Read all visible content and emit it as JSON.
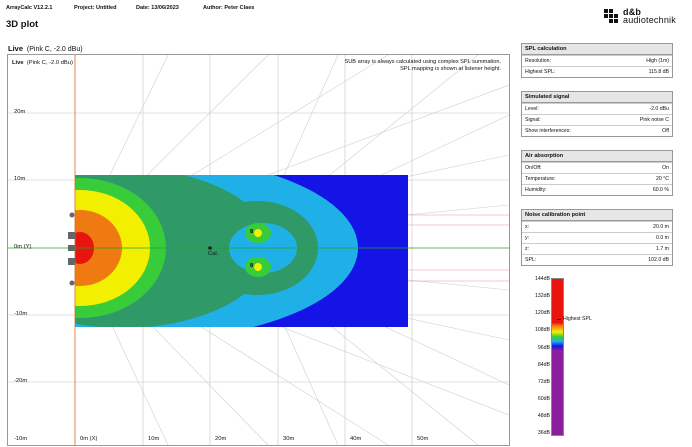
{
  "header": {
    "app": "ArrayCalc V12.2.1",
    "project": "Project: Untitled",
    "date": "Date: 13/06/2023",
    "author": "Author: Peter Claes",
    "title": "3D plot"
  },
  "logo": {
    "line1": "d&b",
    "line2": "audiotechnik"
  },
  "plot": {
    "title_bold": "Live",
    "title_rest": "(Pink C, -2.0 dBu)",
    "inner_bold": "Live",
    "inner_rest": "(Pink C, -2.0 dBu)",
    "note1": "SUB array is always calculated using complex SPL summation.",
    "note2": "SPL mapping is shown at listener height.",
    "y_ticks": [
      "20m",
      "10m",
      "0m (Y)",
      "-10m",
      "-20m"
    ],
    "x_ticks": [
      "-10m",
      "0m (X)",
      "10m",
      "20m",
      "30m",
      "40m",
      "50m"
    ],
    "cal_label": "Cal.",
    "src_a": "8",
    "src_b": "8"
  },
  "spl_calc": {
    "title": "SPL calculation",
    "rows": [
      {
        "k": "Resolution:",
        "v": "High (1m)"
      },
      {
        "k": "Highest SPL:",
        "v": "115.8 dB"
      }
    ]
  },
  "sim_signal": {
    "title": "Simulated signal",
    "rows": [
      {
        "k": "Level:",
        "v": "-2.0 dBu"
      },
      {
        "k": "Signal:",
        "v": "Pink noise C"
      },
      {
        "k": "Show interferences:",
        "v": "Off"
      }
    ]
  },
  "air": {
    "title": "Air absorption",
    "rows": [
      {
        "k": "On/Off:",
        "v": "On"
      },
      {
        "k": "Temperature:",
        "v": "20 °C"
      },
      {
        "k": "Humidity:",
        "v": "60.0 %"
      }
    ]
  },
  "noise_cal": {
    "title": "Noise calibration point",
    "rows": [
      {
        "k": "x:",
        "v": "20.0 m"
      },
      {
        "k": "y:",
        "v": "0.0 m"
      },
      {
        "k": "z:",
        "v": "1.7 m"
      },
      {
        "k": "SPL:",
        "v": "102.0 dB"
      }
    ]
  },
  "scale": {
    "labels": [
      "144dB",
      "132dB",
      "120dB",
      "108dB",
      "96dB",
      "84dB",
      "72dB",
      "60dB",
      "48dB",
      "36dB"
    ],
    "highest_label": "Highest SPL"
  },
  "colors": {
    "red": "#e8140e",
    "orange": "#f07a12",
    "yellow": "#f2f000",
    "green": "#38cc3a",
    "darkgreen": "#2f9a68",
    "cyan": "#1fb0e8",
    "blue": "#1414e6",
    "purple": "#8a1e9c"
  }
}
